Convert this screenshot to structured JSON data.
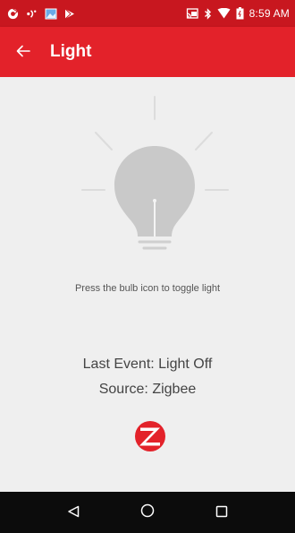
{
  "status_bar": {
    "time": "8:59 AM",
    "left_icons": [
      "chrome-icon",
      "signal-dots-icon",
      "photo-icon",
      "play-store-icon"
    ],
    "right_icons": [
      "cast-icon",
      "bluetooth-icon",
      "wifi-icon",
      "battery-icon"
    ],
    "background_color": "#c8171f"
  },
  "app_bar": {
    "title": "Light",
    "back_icon": "arrow-left-icon",
    "background_color": "#e3222a"
  },
  "light": {
    "state": "off",
    "bulb_icon": "lightbulb-icon",
    "hint": "Press the bulb icon to toggle light"
  },
  "event": {
    "last_event": "Last Event: Light Off",
    "source": "Source: Zigbee"
  },
  "logo": {
    "icon": "zigbee-logo-icon",
    "color": "#e3222a"
  },
  "nav_bar": {
    "back_icon": "nav-back-icon",
    "home_icon": "nav-home-icon",
    "recents_icon": "nav-recents-icon",
    "background_color": "#0c0c0c"
  }
}
